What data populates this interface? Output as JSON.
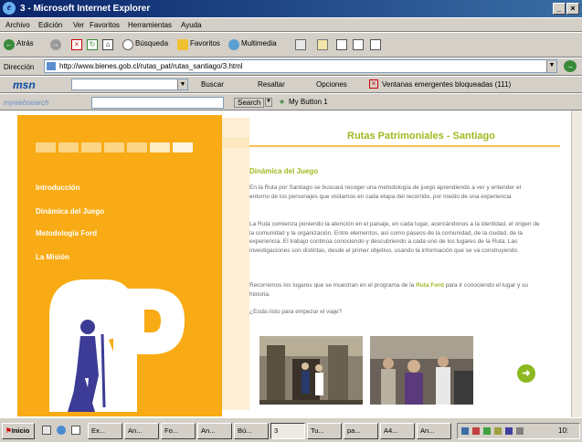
{
  "window": {
    "title": "3 - Microsoft Internet Explorer",
    "icon": "ie-icon",
    "minimize": "_",
    "close": "×"
  },
  "menu": [
    "Archivo",
    "Edición",
    "Ver",
    "Favoritos",
    "Herramientas",
    "Ayuda"
  ],
  "toolbar": {
    "back": "Atrás",
    "search": "Búsqueda",
    "favorites": "Favoritos",
    "multimedia": "Multimedia"
  },
  "address": {
    "label": "Dirección",
    "url": "http://www.bienes.gob.cl/rutas_pat/rutas_santiago/3.html"
  },
  "msn": {
    "logo": "msn",
    "search": "Buscar",
    "highlight": "Resaltar",
    "options": "Opciones",
    "popups": "Ventanas emergentes bloqueadas (111)"
  },
  "websearch": {
    "logo": "mywebsearch",
    "search": "Search",
    "button": "My Button 1"
  },
  "page": {
    "title": "Rutas Patrimoniales - Santiago",
    "nav": [
      "Introducción",
      "Dinámica del Juego",
      "Metodología Ford",
      "La Misión"
    ],
    "section_title": "Dinámica del Juego",
    "para1": "En la Ruta por Santiago se buscará recoger una metodología de juego aprendiendo a ver y entender el entorno de los personajes que visitamos en cada etapa del recorrido, por medio de una experiencia",
    "para2": "La Ruta comienza poniendo la atención en el paisaje, en cada lugar, acercándonos a la identidad, el origen de la comunidad y la organización. Entre elementos, así como paseos de la comunidad, de la ciudad, de la experiencia. El trabajo continúa conociendo y descubriendo a cada uno de los lugares de la Ruta. Las investigaciones son distintas, desde el primer objetivo, usando la información que se va construyendo.",
    "para3_pre": "Recorremos los lugares que se muestran en el programa de la",
    "para3_link": "Ruta Ford",
    "para3_post": "para ir conociendo el lugar y su historia.",
    "para4": "¿Estás listo para empezar el viaje?",
    "next_button": "➜"
  },
  "taskbar": {
    "start": "Inicio",
    "items": [
      "Ex...",
      "An...",
      "Fo...",
      "An...",
      "Bú...",
      "3",
      "Tu...",
      "pa...",
      "A4...",
      "An..."
    ],
    "clock": "10:"
  }
}
